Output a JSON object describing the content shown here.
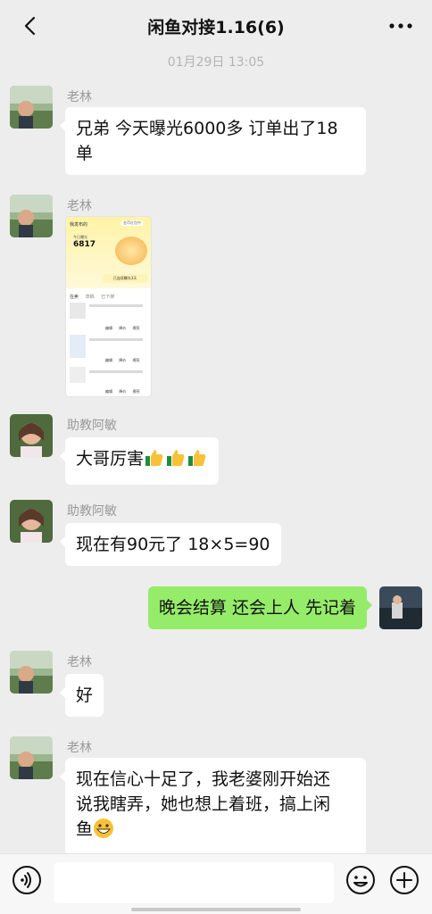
{
  "header": {
    "title": "闲鱼对接1.16(6)"
  },
  "timestamp": "01月29日 13:05",
  "messages": [
    {
      "sender": "老林",
      "text_line1": "兄弟 今天曝光6000多 订单出了18",
      "text_line2": "单"
    },
    {
      "sender": "老林",
      "image": {
        "top_left": "我发布的",
        "badge": "金币红包中",
        "stat_label": "今日曝光",
        "stat_value": "6817",
        "pill": "已连续曝光3天",
        "tabs": [
          "在卖",
          "草稿",
          "已下架"
        ],
        "row_actions": [
          "编辑",
          "降价",
          "擦亮"
        ]
      }
    },
    {
      "sender": "助教阿敏",
      "text": "大哥厉害",
      "emojis": [
        "thumbs-up",
        "thumbs-up",
        "thumbs-up"
      ]
    },
    {
      "sender": "助教阿敏",
      "text": "现在有90元了  18×5=90"
    },
    {
      "sender": "self",
      "text": "晚会结算 还会上人 先记着"
    },
    {
      "sender": "老林",
      "text": "好"
    },
    {
      "sender": "老林",
      "text_line1": "现在信心十足了，我老婆刚开始还",
      "text_line2": "说我瞎弄，她也想上着班，搞上闲",
      "text_line3": "鱼",
      "emoji": "grinning-face"
    }
  ],
  "icons": {
    "back": "chevron-left-icon",
    "more": "more-dots-icon",
    "voice": "voice-icon",
    "emoji": "smiley-icon",
    "plus": "plus-icon"
  },
  "colors": {
    "background": "#ededed",
    "bubble_self": "#95ec69",
    "bubble_other": "#ffffff",
    "muted_text": "#9a9a9a"
  }
}
